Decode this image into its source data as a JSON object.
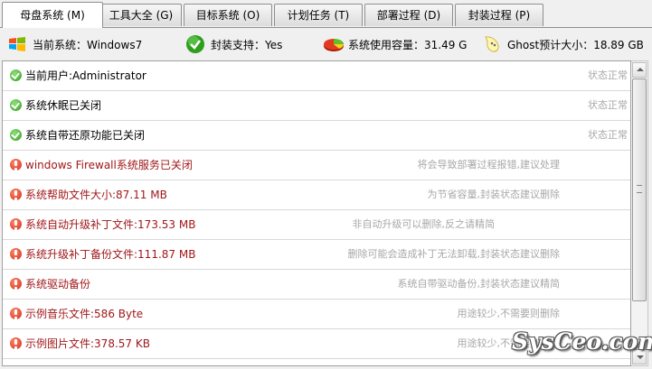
{
  "tabs": [
    {
      "label": "母盘系统 (M)",
      "active": true
    },
    {
      "label": "工具大全 (G)",
      "active": false
    },
    {
      "label": "目标系统 (O)",
      "active": false
    },
    {
      "label": "计划任务 (T)",
      "active": false
    },
    {
      "label": "部署过程 (D)",
      "active": false
    },
    {
      "label": "封装过程 (P)",
      "active": false
    }
  ],
  "info_bar": {
    "current_system": "当前系统：Windows7",
    "encapsulation_support": "封装支持：Yes",
    "system_usage": "系统使用容量：31.49 G",
    "ghost_size": "Ghost预计大小：18.89 GB"
  },
  "items": [
    {
      "status": "ok",
      "text": "当前用户:Administrator",
      "note": "状态正常"
    },
    {
      "status": "ok",
      "text": "系统休眠已关闭",
      "note": "状态正常"
    },
    {
      "status": "ok",
      "text": "系统自带还原功能已关闭",
      "note": "状态正常"
    },
    {
      "status": "warn",
      "text": "windows Firewall系统服务已关闭",
      "note": "将会导致部署过程报错,建议处理"
    },
    {
      "status": "warn",
      "text": "系统帮助文件大小:87.11 MB",
      "note": "为节省容量,封装状态建议删除"
    },
    {
      "status": "warn",
      "text": "系统自动升级补丁文件:173.53 MB",
      "note": "非自动升级可以删除,反之请精简"
    },
    {
      "status": "warn",
      "text": "系统升级补丁备份文件:111.87 MB",
      "note": "删除可能会造成补丁无法卸载,封装状态建议删除"
    },
    {
      "status": "warn",
      "text": "系统驱动备份",
      "note": "系统自带驱动备份,封装状态建议精简"
    },
    {
      "status": "warn",
      "text": "示例音乐文件:586 Byte",
      "note": "用途较少,不需要则删除"
    },
    {
      "status": "warn",
      "text": "示例图片文件:378.57 KB",
      "note": "用途较少,不需要则删除"
    }
  ],
  "watermark": "SysCeo.com",
  "colors": {
    "warn_text": "#a0181a",
    "note_text": "#a8a8a8",
    "ok_icon": "#2f9e1f",
    "warn_icon": "#d2291a"
  }
}
